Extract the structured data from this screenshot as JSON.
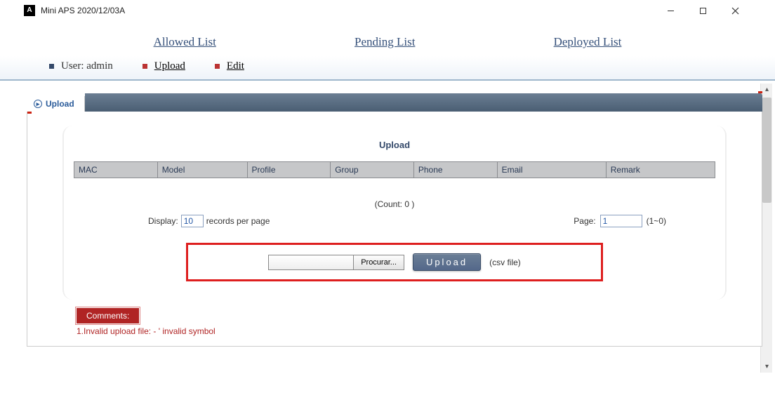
{
  "window": {
    "title": "Mini APS 2020/12/03A"
  },
  "topnav": {
    "allowed": "Allowed List",
    "pending": "Pending List",
    "deployed": "Deployed List"
  },
  "subbar": {
    "user_label": "User: admin",
    "upload": "Upload",
    "edit": "Edit"
  },
  "panel": {
    "tab_label": "Upload",
    "section_title": "Upload",
    "columns": {
      "mac": "MAC",
      "model": "Model",
      "profile": "Profile",
      "group": "Group",
      "phone": "Phone",
      "email": "Email",
      "remark": "Remark"
    },
    "count_text": "(Count: 0  )",
    "display_label": "Display:",
    "display_value": "10",
    "records_label": "records per page",
    "page_label": "Page:",
    "page_value": "1",
    "page_range": "(1~0)",
    "browse_btn": "Procurar...",
    "upload_btn": "Upload",
    "csv_hint": "(csv file)"
  },
  "comments": {
    "label": "Comments:",
    "line1": "1.Invalid upload file: - ' invalid symbol"
  }
}
